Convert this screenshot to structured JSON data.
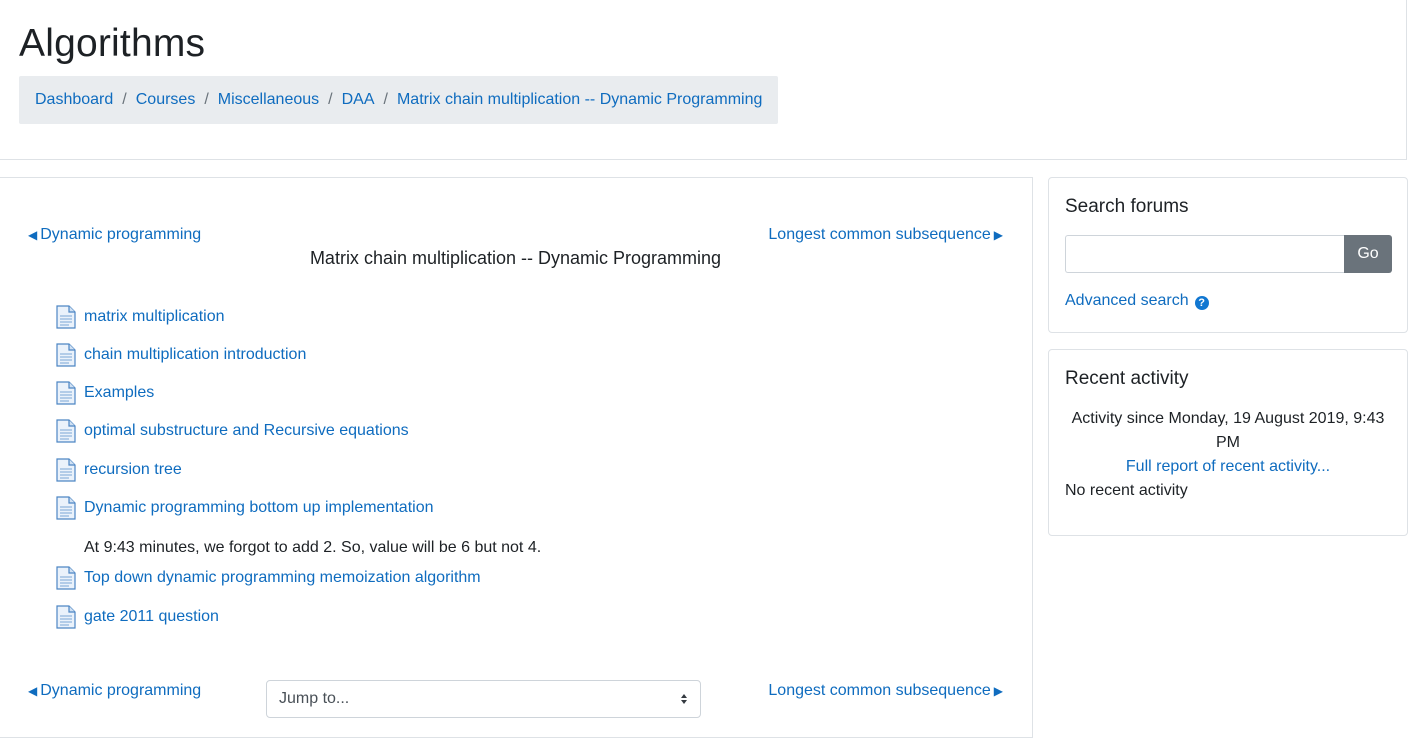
{
  "header": {
    "title": "Algorithms",
    "breadcrumb": [
      "Dashboard",
      "Courses",
      "Miscellaneous",
      "DAA",
      "Matrix chain multiplication -- Dynamic Programming"
    ],
    "separator": "/"
  },
  "main": {
    "prev_link": "Dynamic programming",
    "next_link": "Longest common subsequence",
    "section_title": "Matrix chain multiplication -- Dynamic Programming",
    "activities": [
      "matrix multiplication",
      "chain multiplication introduction",
      "Examples",
      "optimal substructure and Recursive equations",
      "recursion tree",
      "Dynamic programming bottom up implementation",
      "Top down dynamic programming memoization algorithm",
      "gate 2011 question"
    ],
    "note": "At 9:43 minutes, we forgot to add 2. So, value will be 6 but not 4.",
    "jump_select": "Jump to...",
    "icons": {
      "activity": "page-icon",
      "prev": "triangle-left-icon",
      "next": "triangle-right-icon"
    }
  },
  "search_block": {
    "title": "Search forums",
    "input_value": "",
    "go_label": "Go",
    "advanced_label": "Advanced search",
    "help_glyph": "?"
  },
  "recent_block": {
    "title": "Recent activity",
    "since": "Activity since Monday, 19 August 2019, 9:43 PM",
    "full_report": "Full report of recent activity...",
    "none": "No recent activity"
  },
  "colors": {
    "link": "#0f6cbf",
    "go_button": "#6a737b",
    "breadcrumb_bg": "#e9ecef",
    "help_icon": "#1177d1"
  }
}
